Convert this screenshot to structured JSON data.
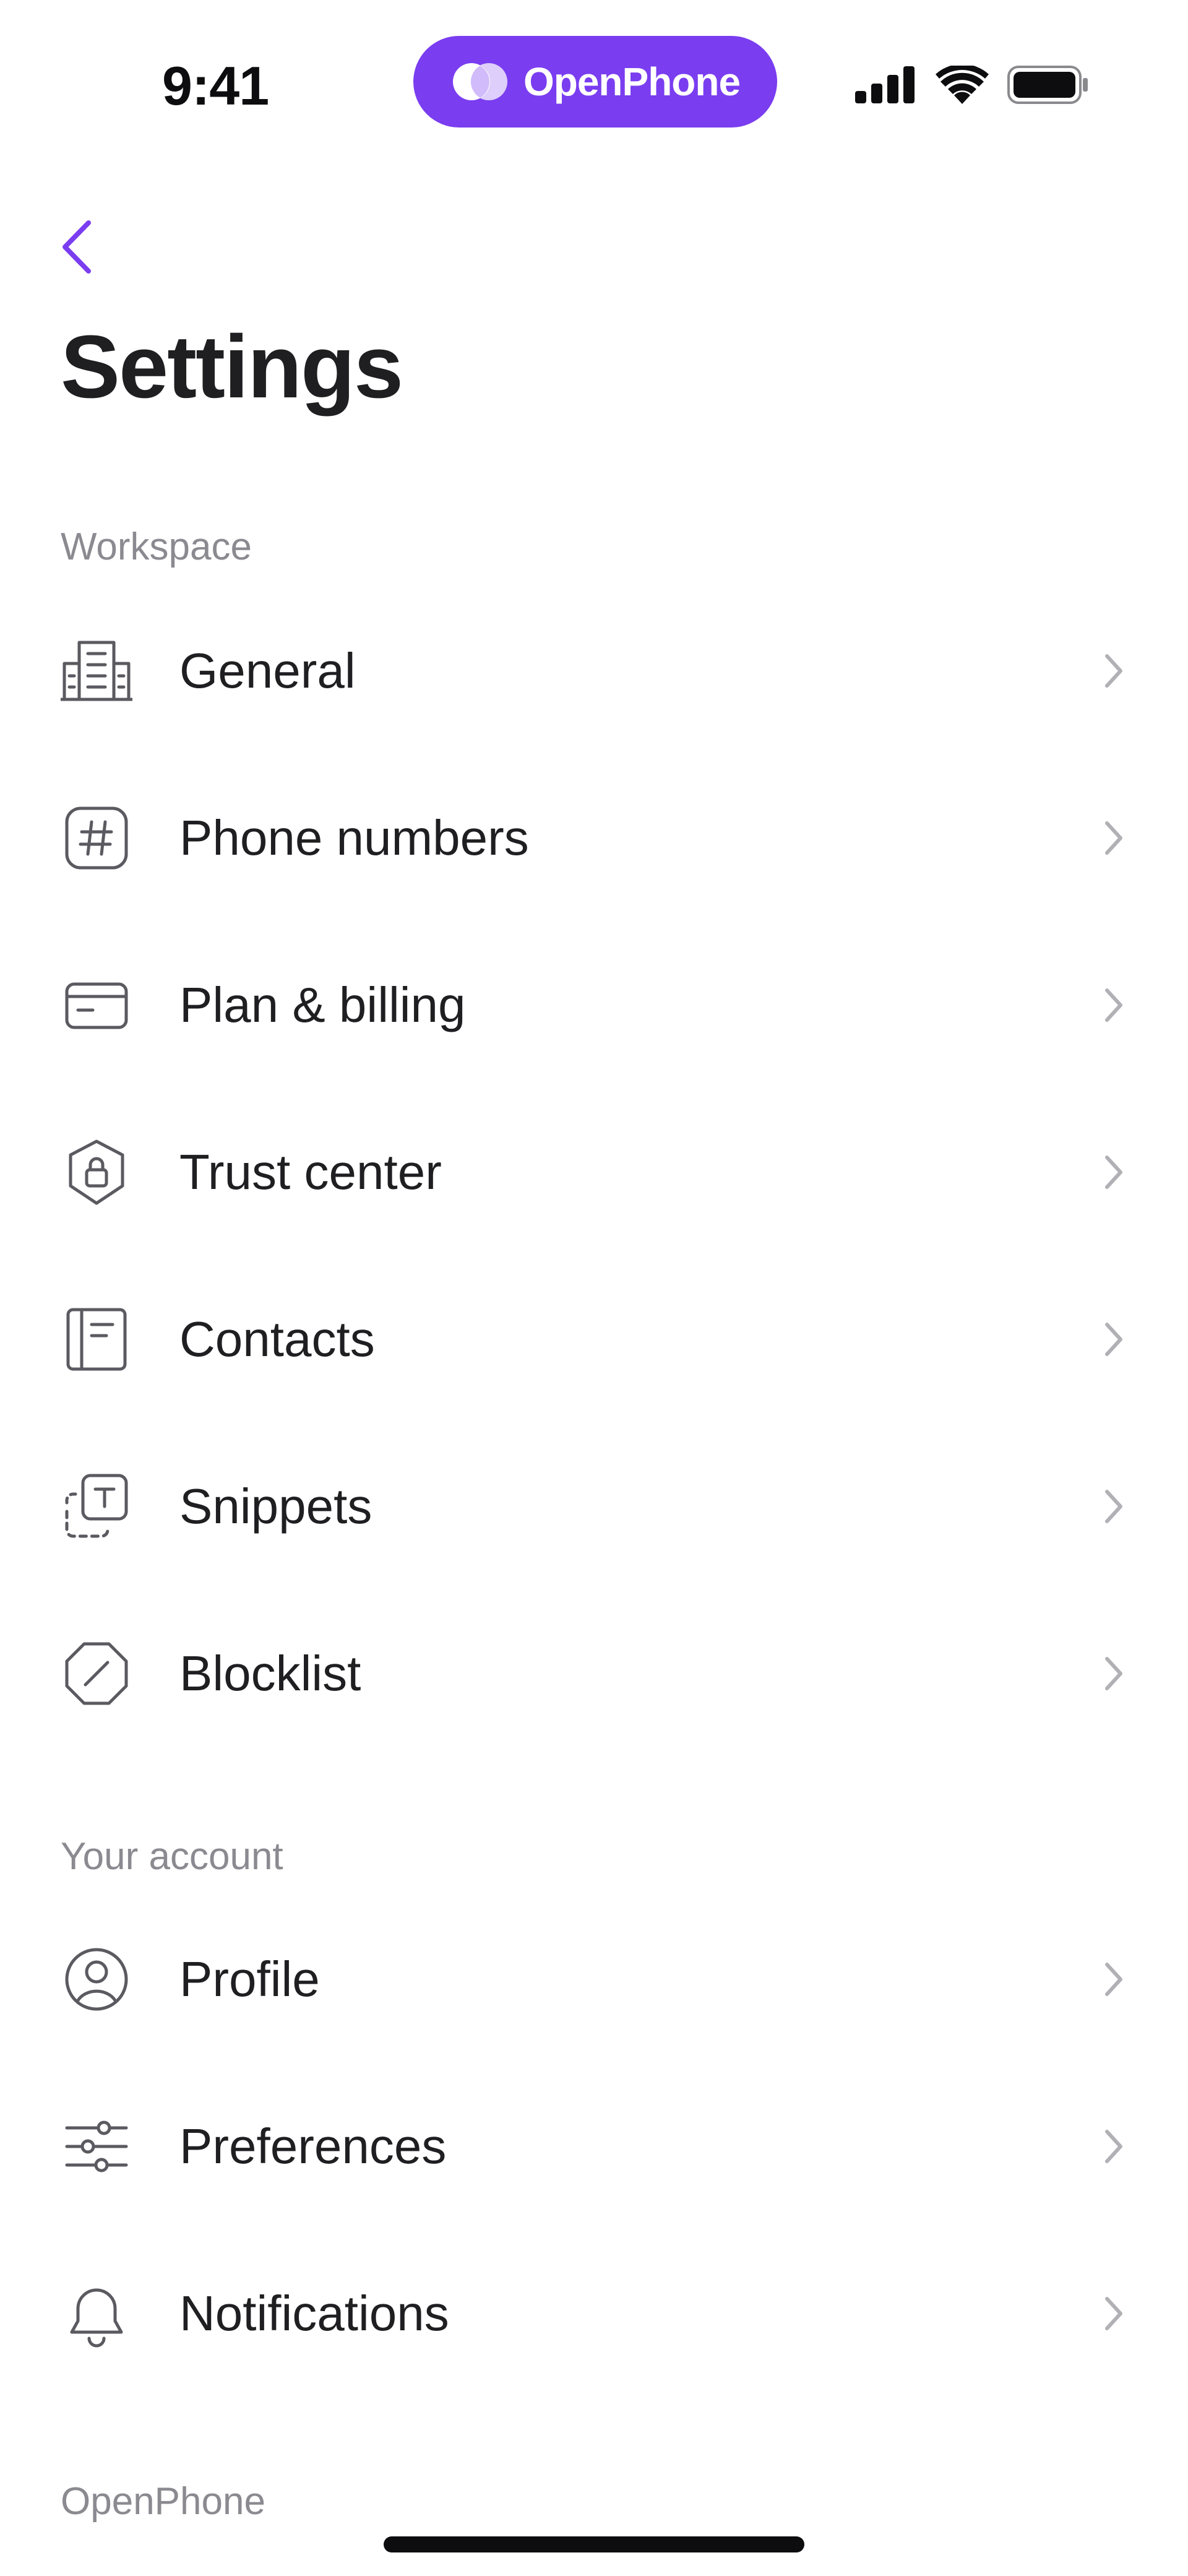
{
  "status_bar": {
    "time": "9:41",
    "brand": "OpenPhone",
    "accent_color": "#7a3df0",
    "icons": [
      "cellular-signal-icon",
      "wifi-icon",
      "battery-icon"
    ]
  },
  "header": {
    "back_icon": "chevron-left-icon",
    "title": "Settings"
  },
  "sections": {
    "workspace": {
      "label": "Workspace",
      "items": [
        {
          "label": "General",
          "icon": "building-icon"
        },
        {
          "label": "Phone numbers",
          "icon": "hash-icon"
        },
        {
          "label": "Plan & billing",
          "icon": "credit-card-icon"
        },
        {
          "label": "Trust center",
          "icon": "shield-lock-icon"
        },
        {
          "label": "Contacts",
          "icon": "contacts-book-icon"
        },
        {
          "label": "Snippets",
          "icon": "snippet-icon"
        },
        {
          "label": "Blocklist",
          "icon": "block-icon"
        }
      ]
    },
    "account": {
      "label": "Your account",
      "items": [
        {
          "label": "Profile",
          "icon": "user-circle-icon"
        },
        {
          "label": "Preferences",
          "icon": "sliders-icon"
        },
        {
          "label": "Notifications",
          "icon": "bell-icon"
        }
      ]
    },
    "openphone": {
      "label": "OpenPhone"
    }
  }
}
